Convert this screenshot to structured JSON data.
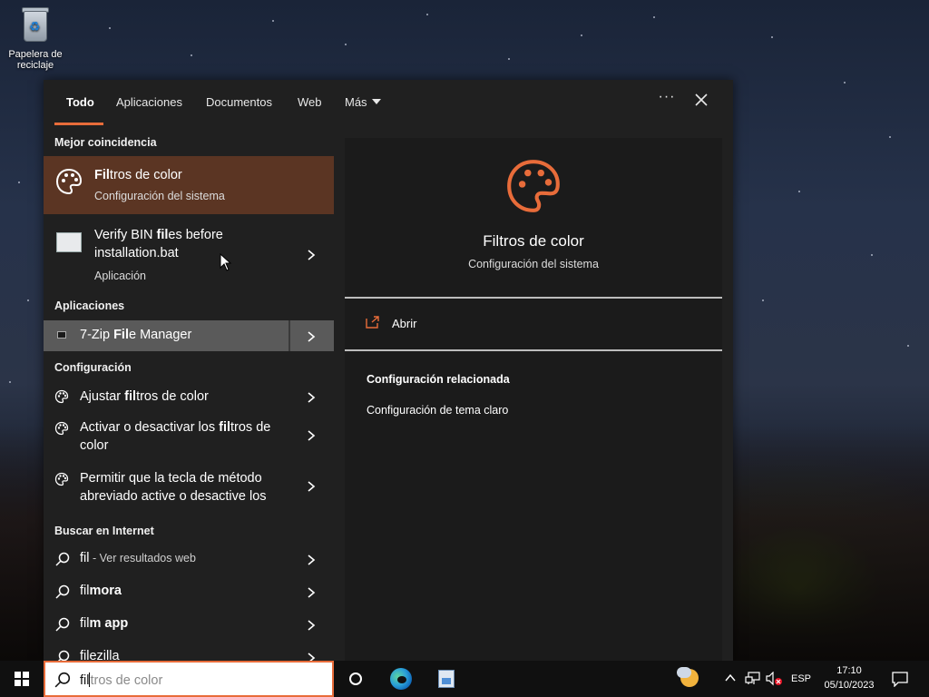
{
  "desktop": {
    "recycle_bin_label": "Papelera de reciclaje"
  },
  "tabs": [
    {
      "label": "Todo",
      "active": true
    },
    {
      "label": "Aplicaciones"
    },
    {
      "label": "Documentos"
    },
    {
      "label": "Web"
    },
    {
      "label": "Más"
    }
  ],
  "topbar": {
    "more_icon": "ellipsis-icon",
    "close_icon": "close-icon"
  },
  "best_match": {
    "section": "Mejor coincidencia",
    "item": {
      "title_pre": "",
      "title_bold": "Fil",
      "title_post": "tros de color",
      "subtitle": "Configuración del sistema",
      "icon": "palette-icon"
    }
  },
  "verify_item": {
    "title_pre": "Verify BIN ",
    "title_bold": "fil",
    "title_post": "es before installation.bat",
    "subtitle": "Aplicación",
    "icon": "batch-file-icon"
  },
  "apps": {
    "section": "Aplicaciones",
    "items": [
      {
        "title_pre": "7-Zip ",
        "title_bold": "Fil",
        "title_post": "e Manager",
        "icon": "7zip-icon"
      }
    ]
  },
  "settings": {
    "section": "Configuración",
    "items": [
      {
        "pre": "Ajustar ",
        "bold": "fil",
        "post": "tros de color"
      },
      {
        "pre": "Activar o desactivar los ",
        "bold": "fil",
        "post": "tros de color"
      },
      {
        "pre": "Permitir que la tecla de método abreviado active o desactive los",
        "bold": "",
        "post": ""
      }
    ]
  },
  "web": {
    "section": "Buscar en Internet",
    "items": [
      {
        "pre": "fil",
        "bold": "",
        "post": "",
        "dim": " - Ver resultados web"
      },
      {
        "pre": "fil",
        "bold": "mora",
        "post": "",
        "dim": ""
      },
      {
        "pre": "fil",
        "bold": "m app",
        "post": "",
        "dim": ""
      },
      {
        "pre": "filezilla",
        "bold": "",
        "post": "",
        "dim": ""
      }
    ]
  },
  "preview": {
    "title": "Filtros de color",
    "subtitle": "Configuración del sistema",
    "open_label": "Abrir",
    "related_title": "Configuración relacionada",
    "related_link": "Configuración de tema claro"
  },
  "taskbar": {
    "search_typed": "fil",
    "search_hint": "tros de color",
    "language": "ESP",
    "time": "17:10",
    "date": "05/10/2023"
  },
  "colors": {
    "accent": "#e86c3a",
    "panel_bg": "#202020",
    "selected_bg": "#5b3523"
  }
}
